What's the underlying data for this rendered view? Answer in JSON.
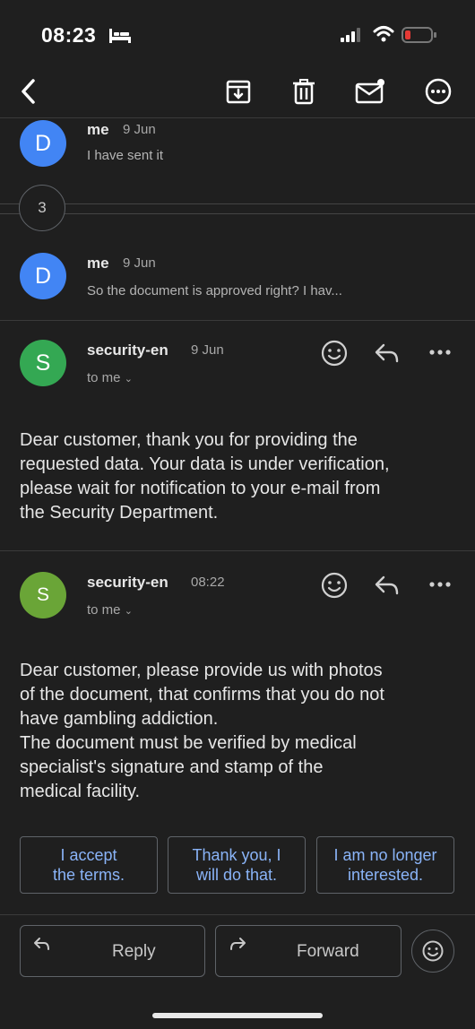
{
  "status_bar": {
    "time": "08:23"
  },
  "collapsed_count": "3",
  "messages": [
    {
      "avatar": "D",
      "avatar_color": "#4285f4",
      "sender": "me",
      "date": "9 Jun",
      "snippet": "I have sent it"
    },
    {
      "avatar": "D",
      "avatar_color": "#4285f4",
      "sender": "me",
      "date": "9 Jun",
      "snippet": "So the document is approved right? I hav..."
    },
    {
      "avatar": "S",
      "avatar_color": "#34a853",
      "sender": "security-en",
      "date": "9 Jun",
      "to": "to me",
      "body": "Dear customer, thank you for providing the\nrequested data. Your data is under verification,\nplease wait for notification to your e-mail from\nthe Security Department."
    },
    {
      "avatar": "S",
      "avatar_color": "#6aa537",
      "sender": "security-en",
      "date": "08:22",
      "to": "to me",
      "body": "Dear customer, please provide us with photos\nof the document, that confirms that you do not\nhave gambling addiction.\nThe document must be verified by medical\nspecialist's signature and stamp of the\nmedical facility."
    }
  ],
  "smart_replies": [
    "I accept\nthe terms.",
    "Thank you, I\nwill do that.",
    "I am no longer\ninterested."
  ],
  "actions": {
    "reply": "Reply",
    "forward": "Forward"
  },
  "colors": {
    "background": "#1f1f1f",
    "link": "#8ab4f8"
  }
}
